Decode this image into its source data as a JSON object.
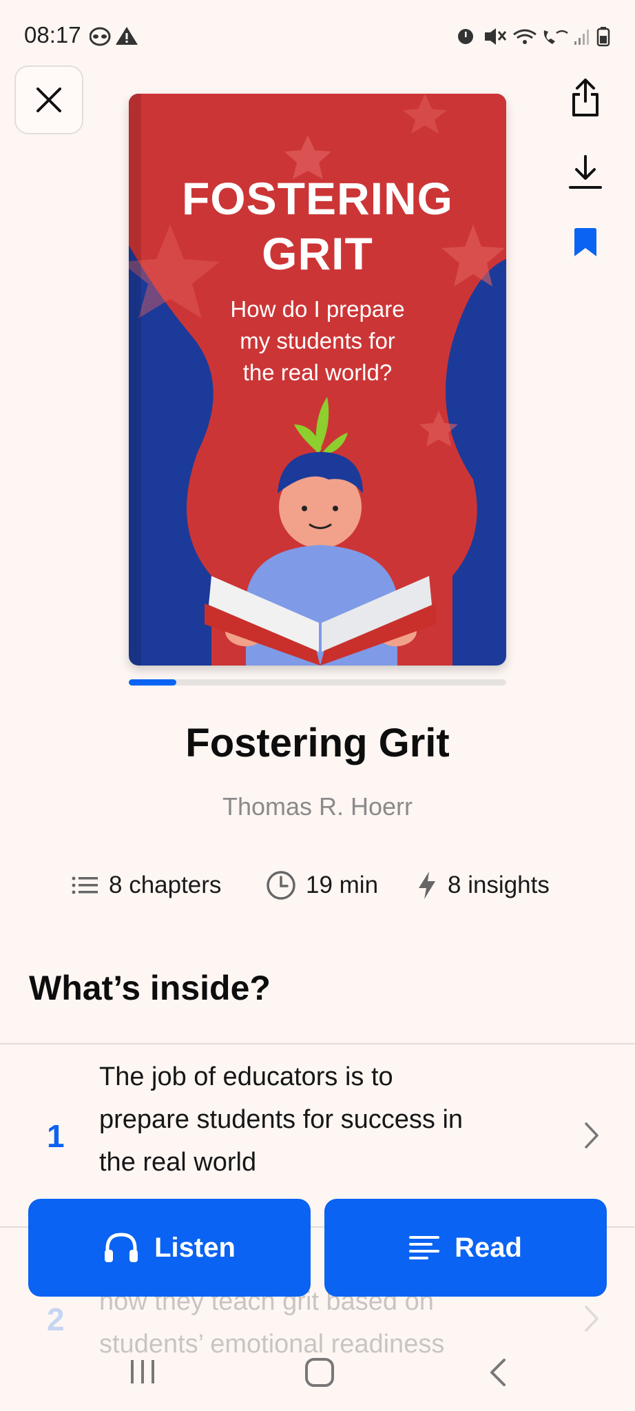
{
  "status_bar": {
    "time": "08:17",
    "left_icons": [
      "raccoon-icon",
      "warning-icon"
    ],
    "right_icons": [
      "alarm-icon",
      "mute-icon",
      "wifi-icon",
      "wifi-calling-icon",
      "signal-icon",
      "battery-icon"
    ]
  },
  "top_actions": {
    "close_icon": "close-icon",
    "share_icon": "share-icon",
    "download_icon": "download-icon",
    "bookmark_icon": "bookmark-icon"
  },
  "cover": {
    "title_line1": "FOSTERING",
    "title_line2": "GRIT",
    "subtitle_line1": "How do I prepare",
    "subtitle_line2": "my students for",
    "subtitle_line3": "the real world?"
  },
  "progress": {
    "fraction": 0.125
  },
  "book": {
    "title": "Fostering Grit",
    "author": "Thomas R. Hoerr"
  },
  "meta": {
    "chapters": "8 chapters",
    "duration": "19 min",
    "insights": "8 insights"
  },
  "section_title": "What’s inside?",
  "chapters": [
    {
      "number": "1",
      "lines": [
        "The job of educators is to",
        "prepare students for success in",
        "the real world"
      ]
    },
    {
      "number": "2",
      "lines": [
        "",
        "how they teach grit based on",
        "students’ emotional readiness"
      ]
    }
  ],
  "buttons": {
    "listen": "Listen",
    "read": "Read"
  },
  "colors": {
    "accent": "#0a63f2",
    "background": "#fdf6f3",
    "cover_red": "#cc3536",
    "cover_blue": "#1c3a99"
  },
  "nav_bar": [
    "recents-icon",
    "home-icon",
    "back-icon"
  ]
}
